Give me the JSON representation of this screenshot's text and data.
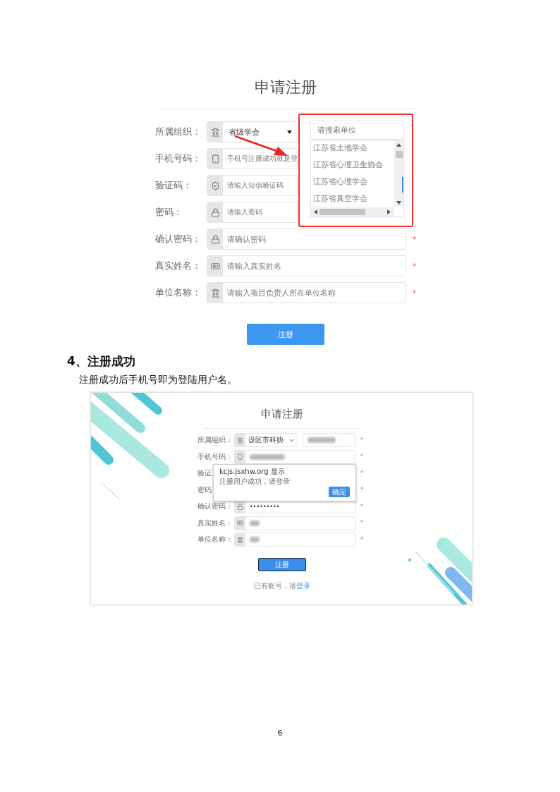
{
  "register_form": {
    "title": "申请注册",
    "rows": [
      {
        "label": "所属组织：",
        "kind": "select",
        "value": "省级学会"
      },
      {
        "label": "手机号码：",
        "kind": "input",
        "placeholder": "手机号注册成功就是登"
      },
      {
        "label": "验证码：",
        "kind": "input",
        "placeholder": "请输入短信验证码"
      },
      {
        "label": "密码：",
        "kind": "input",
        "placeholder": "请输入密码"
      },
      {
        "label": "确认密码：",
        "kind": "input",
        "placeholder": "请确认密码",
        "required_mark": "*"
      },
      {
        "label": "真实姓名：",
        "kind": "input",
        "placeholder": "请输入真实姓名",
        "required_mark": "*"
      },
      {
        "label": "单位名称：",
        "kind": "input",
        "placeholder": "请输入项目负责人所在单位名称",
        "required_mark": "*"
      }
    ],
    "org_dropdown": {
      "search_placeholder": "请搜索单位",
      "options": [
        "江苏省土地学会",
        "江苏省心理卫生协会",
        "江苏省心理学会",
        "江苏省真空学会"
      ]
    },
    "submit_button": "注册"
  },
  "section_heading": "4、注册成功",
  "section_text": "注册成功后手机号即为登陆用户名。",
  "success_screen": {
    "title": "申请注册",
    "rows": [
      {
        "label": "所属组织：",
        "kind": "select",
        "value": "设区市科协",
        "required_mark": "*"
      },
      {
        "label": "手机号码：",
        "kind": "redacted",
        "required_mark": "*"
      },
      {
        "label": "验证",
        "kind": "hidden",
        "required_mark": "*"
      },
      {
        "label": "密码",
        "kind": "hidden",
        "required_mark": "*"
      },
      {
        "label": "确认密码：",
        "kind": "input",
        "value": "•••••••••",
        "required_mark": "*"
      },
      {
        "label": "真实姓名：",
        "kind": "redacted",
        "required_mark": "*"
      },
      {
        "label": "单位名称：",
        "kind": "redacted",
        "required_mark": "*"
      }
    ],
    "submit_button": "注册",
    "footer_text": "已有账号，请",
    "footer_link": "登录",
    "alert": {
      "title": "kcjs.jsxhw.org 显示",
      "message": "注册用户成功，请登录",
      "ok_button": "确定"
    }
  },
  "page_number": "6"
}
